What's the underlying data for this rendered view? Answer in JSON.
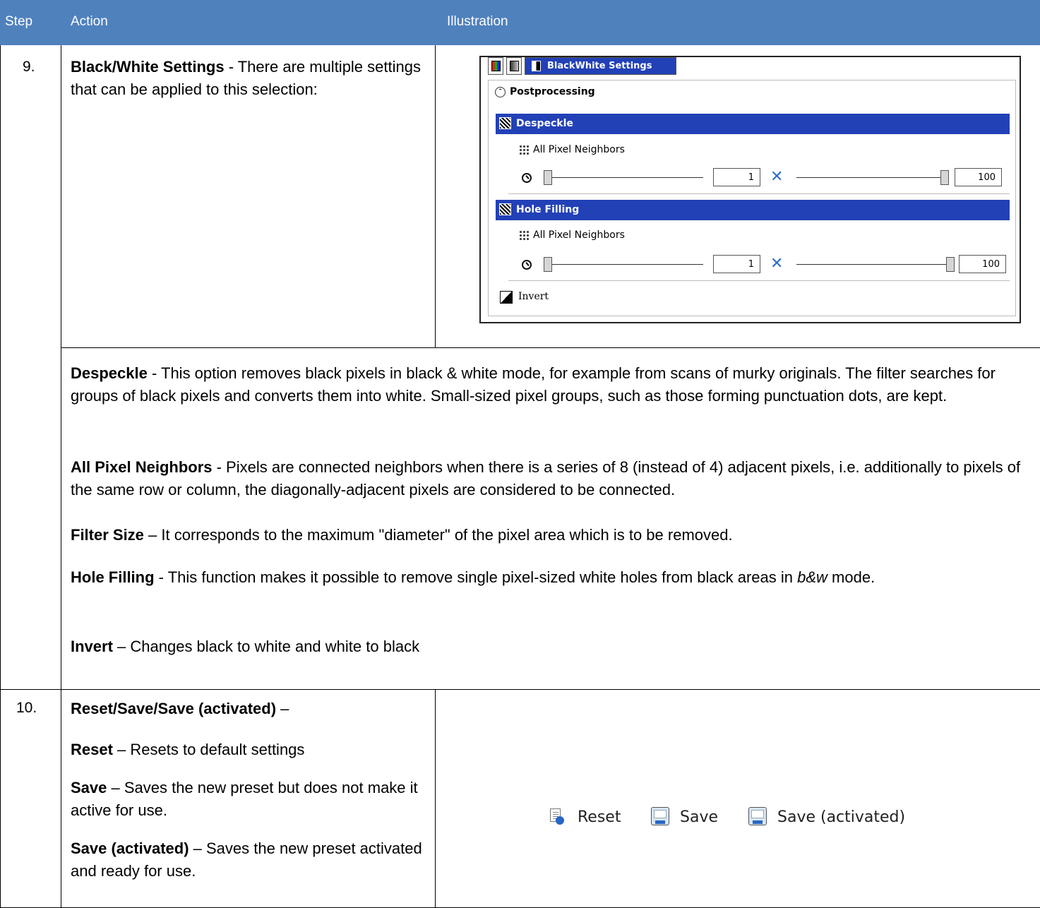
{
  "header": {
    "step": "Step",
    "action": "Action",
    "illustration": "Illustration"
  },
  "row9": {
    "step": "9.",
    "title": "Black/White Settings",
    "intro": " - There are multiple settings that can be applied to this selection:",
    "panel": {
      "tab_label": "BlackWhite Settings",
      "section": "Postprocessing",
      "despeckle": {
        "label": "Despeckle",
        "neighbors": "All Pixel Neighbors",
        "min": "1",
        "max": "100"
      },
      "hole_filling": {
        "label": "Hole Filling",
        "neighbors": "All Pixel Neighbors",
        "min": "1",
        "max": "100"
      },
      "invert": "Invert"
    },
    "details": {
      "despeckle_term": "Despeckle",
      "despeckle_text": " - This option removes black pixels in black & white mode, for example from scans of murky originals. The filter searches for groups of black pixels and converts them into white. Small-sized pixel groups, such as those forming punctuation dots, are kept.",
      "neighbors_term": "All Pixel Neighbors",
      "neighbors_text": " - Pixels are connected neighbors when there is a series of 8 (instead of 4) adjacent pixels, i.e. additionally to pixels of the same row or column, the diagonally-adjacent pixels are considered to be connected.",
      "filter_term": "Filter Size",
      "filter_text": " – It corresponds to the maximum \"diameter\" of the pixel area which is to be removed.",
      "hole_term": "Hole Filling",
      "hole_text": " - This function makes it possible to remove single pixel-sized white holes from black areas in ",
      "hole_italic": "b&w",
      "hole_end": " mode.",
      "invert_term": "Invert",
      "invert_text": " – Changes black to white and white to black"
    }
  },
  "row10": {
    "step": "10.",
    "title": "Reset/Save/Save (activated)",
    "title_dash": " –",
    "reset_term": "Reset",
    "reset_text": " – Resets to default settings",
    "save_term": "Save",
    "save_text": " – Saves the new preset but does not make it active for use.",
    "save_act_term": "Save (activated)",
    "save_act_text": " – Saves the new preset activated and ready for use.",
    "toolbar": {
      "reset": "Reset",
      "save": "Save",
      "save_activated": "Save (activated)"
    }
  }
}
